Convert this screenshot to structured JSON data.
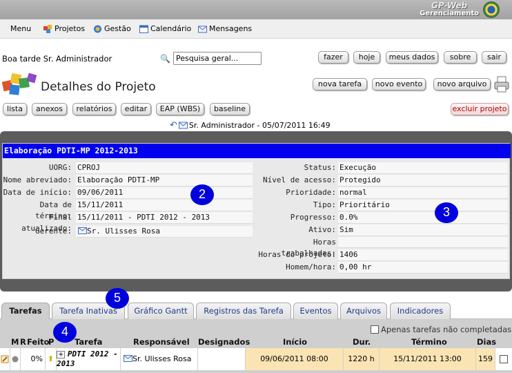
{
  "brand": {
    "line1": "GP-Web",
    "line2": "Gerenciamento"
  },
  "menu": [
    {
      "label": "Menu",
      "icon": "none"
    },
    {
      "label": "Projetos",
      "icon": "puzzle-icon"
    },
    {
      "label": "Gestão",
      "icon": "gestao-icon"
    },
    {
      "label": "Calendário",
      "icon": "calendar-icon"
    },
    {
      "label": "Mensagens",
      "icon": "envelope-icon"
    }
  ],
  "greeting": "Boa tarde Sr. Administrador",
  "search": {
    "value": "Pesquisa geral..."
  },
  "top_buttons": [
    "fazer",
    "hoje",
    "meus dados",
    "sobre",
    "sair"
  ],
  "page_title": "Detalhes do Projeto",
  "action_buttons": [
    "nova tarefa",
    "novo evento",
    "novo arquivo"
  ],
  "tool_buttons": [
    "lista",
    "anexos",
    "relatórios",
    "editar",
    "EAP (WBS)",
    "baseline"
  ],
  "delete_button": "excluir projeto",
  "stamp": "Sr. Administrador - 05/07/2011 16:49",
  "project": {
    "name": "Elaboração PDTI-MP 2012-2013",
    "left": [
      {
        "label": "UORG:",
        "value": "CPROJ"
      },
      {
        "label": "Nome abreviado:",
        "value": "Elaboração PDTI-MP"
      },
      {
        "label": "Data de início:",
        "value": "09/06/2011"
      },
      {
        "label": "Data de término:",
        "value": "15/11/2011"
      },
      {
        "label": "Final atualizado:",
        "value": "15/11/2011 - PDTI 2012 - 2013"
      },
      {
        "label": "Gerente:",
        "value": "Sr. Ulisses Rosa"
      }
    ],
    "right": [
      {
        "label": "Status:",
        "value": "Execução"
      },
      {
        "label": "Nível de acesso:",
        "value": "Protegido"
      },
      {
        "label": "Prioridade:",
        "value": "normal"
      },
      {
        "label": "Tipo:",
        "value": "Prioritário"
      },
      {
        "label": "Progresso:",
        "value": "0.0%"
      },
      {
        "label": "Ativo:",
        "value": "Sim"
      },
      {
        "label": "Horas trabalhadas:",
        "value": ""
      },
      {
        "label": "Horas do projeto:",
        "value": "1406"
      },
      {
        "label": "Homem/hora:",
        "value": "0,00 hr"
      }
    ]
  },
  "badges": [
    "2",
    "3",
    "4",
    "5"
  ],
  "tabs": [
    "Tarefas",
    "Tarefa Inativas",
    "Gráfico Gantt",
    "Registros das Tarefa",
    "Eventos",
    "Arquivos",
    "Indicadores"
  ],
  "only_active_label": "Apenas tarefas não completadas",
  "table": {
    "headers": [
      "M",
      "R",
      "Feito",
      "P",
      "Tarefa",
      "Responsável",
      "Designados",
      "Início",
      "Dur.",
      "Término",
      "Dias"
    ],
    "row": {
      "feito": "0%",
      "tarefa": "PDTI 2012 - 2013",
      "responsavel": "Sr. Ulisses Rosa",
      "designados": "",
      "inicio": "09/06/2011 08:00",
      "dur": "1220 h",
      "termino": "15/11/2011 13:00",
      "dias": "159"
    }
  },
  "colors": {
    "project_bar": "#0000ee",
    "badge": "#0000dd",
    "delete": "#b00000"
  }
}
